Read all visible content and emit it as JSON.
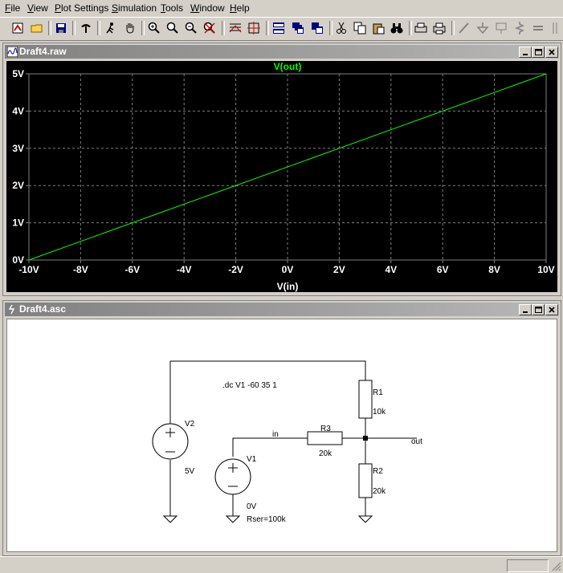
{
  "menu": [
    {
      "label": "File",
      "key": "F",
      "rest": "ile"
    },
    {
      "label": "View",
      "key": "V",
      "rest": "iew"
    },
    {
      "label": "Plot Settings",
      "key": "P",
      "rest": "lot Settings"
    },
    {
      "label": "Simulation",
      "key": "S",
      "rest": "imulation"
    },
    {
      "label": "Tools",
      "key": "T",
      "rest": "ools"
    },
    {
      "label": "Window",
      "key": "W",
      "rest": "indow"
    },
    {
      "label": "Help",
      "key": "H",
      "rest": "elp"
    }
  ],
  "plot_window": {
    "title": "Draft4.raw"
  },
  "schematic_window": {
    "title": "Draft4.asc"
  },
  "chart_data": {
    "type": "line",
    "title": "V(out)",
    "xlabel": "V(in)",
    "ylabel": "",
    "xlim": [
      -10,
      10
    ],
    "ylim": [
      0,
      5
    ],
    "x_ticks": [
      "-10V",
      "-8V",
      "-6V",
      "-4V",
      "-2V",
      "0V",
      "2V",
      "4V",
      "6V",
      "8V",
      "10V"
    ],
    "y_ticks": [
      "0V",
      "1V",
      "2V",
      "3V",
      "4V",
      "5V"
    ],
    "grid": true,
    "series": [
      {
        "name": "V(out)",
        "color": "#00ff00",
        "x": [
          -10,
          10
        ],
        "y": [
          0,
          5
        ]
      }
    ]
  },
  "schematic": {
    "directive": ".dc V1 -60 35 1",
    "v2": {
      "name": "V2",
      "value": "5V"
    },
    "v1": {
      "name": "V1",
      "value": "0V",
      "rser": "Rser=100k"
    },
    "r1": {
      "name": "R1",
      "value": "10k"
    },
    "r2": {
      "name": "R2",
      "value": "20k"
    },
    "r3": {
      "name": "R3",
      "value": "20k"
    },
    "net_in": "in",
    "net_out": "out"
  },
  "colors": {
    "trace": "#00ff00",
    "grid": "#808080",
    "axis_text": "#ffffff",
    "plot_bg": "#000000"
  }
}
